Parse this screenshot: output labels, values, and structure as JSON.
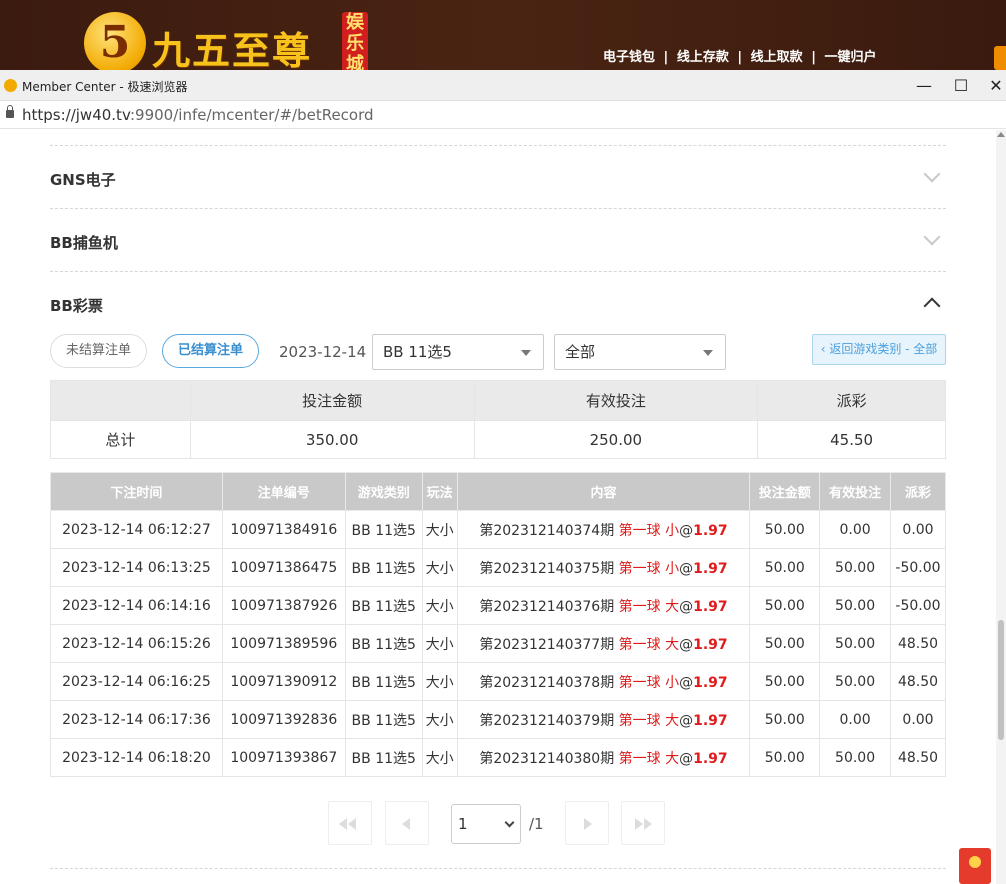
{
  "site": {
    "logo_numeral": "5",
    "logo_name": "九五至尊",
    "logo_tag": "娱乐城",
    "nav": [
      "电子钱包",
      "线上存款",
      "线上取款",
      "一键归户"
    ],
    "nav_sep": "|"
  },
  "browser": {
    "window_title": "Member Center - 极速浏览器",
    "url_host": "https://jw40.tv",
    "url_path": ":9900/infe/mcenter/#/betRecord",
    "minimize": "—",
    "maximize": "☐",
    "close": "✕"
  },
  "sections": [
    {
      "label": "GNS电子",
      "expanded": false
    },
    {
      "label": "BB捕鱼机",
      "expanded": false
    },
    {
      "label": "BB彩票",
      "expanded": true
    }
  ],
  "filters": {
    "unsettled_label": "未结算注单",
    "settled_label": "已结算注单",
    "date": "2023-12-14",
    "game_select": "BB 11选5",
    "type_select": "全部",
    "back_label": "‹ 返回游戏类别 - 全部"
  },
  "summary": {
    "headers": [
      "",
      "投注金额",
      "有效投注",
      "派彩"
    ],
    "row": [
      "总计",
      "350.00",
      "250.00",
      "45.50"
    ]
  },
  "records": {
    "headers": [
      "下注时间",
      "注单编号",
      "游戏类别",
      "玩法",
      "内容",
      "投注金额",
      "有效投注",
      "派彩"
    ],
    "rows": [
      {
        "time": "2023-12-14 06:12:27",
        "id": "100971384916",
        "game": "BB 11选5",
        "play": "大小",
        "period": "第202312140374期",
        "ball": "第一球",
        "pick": "小",
        "at": "@",
        "odds": "1.97",
        "bet": "50.00",
        "valid": "0.00",
        "payout": "0.00",
        "neg": false
      },
      {
        "time": "2023-12-14 06:13:25",
        "id": "100971386475",
        "game": "BB 11选5",
        "play": "大小",
        "period": "第202312140375期",
        "ball": "第一球",
        "pick": "小",
        "at": "@",
        "odds": "1.97",
        "bet": "50.00",
        "valid": "50.00",
        "payout": "-50.00",
        "neg": true
      },
      {
        "time": "2023-12-14 06:14:16",
        "id": "100971387926",
        "game": "BB 11选5",
        "play": "大小",
        "period": "第202312140376期",
        "ball": "第一球",
        "pick": "大",
        "at": "@",
        "odds": "1.97",
        "bet": "50.00",
        "valid": "50.00",
        "payout": "-50.00",
        "neg": true
      },
      {
        "time": "2023-12-14 06:15:26",
        "id": "100971389596",
        "game": "BB 11选5",
        "play": "大小",
        "period": "第202312140377期",
        "ball": "第一球",
        "pick": "大",
        "at": "@",
        "odds": "1.97",
        "bet": "50.00",
        "valid": "50.00",
        "payout": "48.50",
        "neg": false
      },
      {
        "time": "2023-12-14 06:16:25",
        "id": "100971390912",
        "game": "BB 11选5",
        "play": "大小",
        "period": "第202312140378期",
        "ball": "第一球",
        "pick": "小",
        "at": "@",
        "odds": "1.97",
        "bet": "50.00",
        "valid": "50.00",
        "payout": "48.50",
        "neg": false
      },
      {
        "time": "2023-12-14 06:17:36",
        "id": "100971392836",
        "game": "BB 11选5",
        "play": "大小",
        "period": "第202312140379期",
        "ball": "第一球",
        "pick": "大",
        "at": "@",
        "odds": "1.97",
        "bet": "50.00",
        "valid": "0.00",
        "payout": "0.00",
        "neg": false
      },
      {
        "time": "2023-12-14 06:18:20",
        "id": "100971393867",
        "game": "BB 11选5",
        "play": "大小",
        "period": "第202312140380期",
        "ball": "第一球",
        "pick": "大",
        "at": "@",
        "odds": "1.97",
        "bet": "50.00",
        "valid": "50.00",
        "payout": "48.50",
        "neg": false
      }
    ]
  },
  "pagination": {
    "current": "1",
    "total": "/1"
  },
  "colors": {
    "accent_blue": "#3a8fd0",
    "highlight_red": "#e01b1b",
    "header_gray": "#c9c9c9"
  }
}
